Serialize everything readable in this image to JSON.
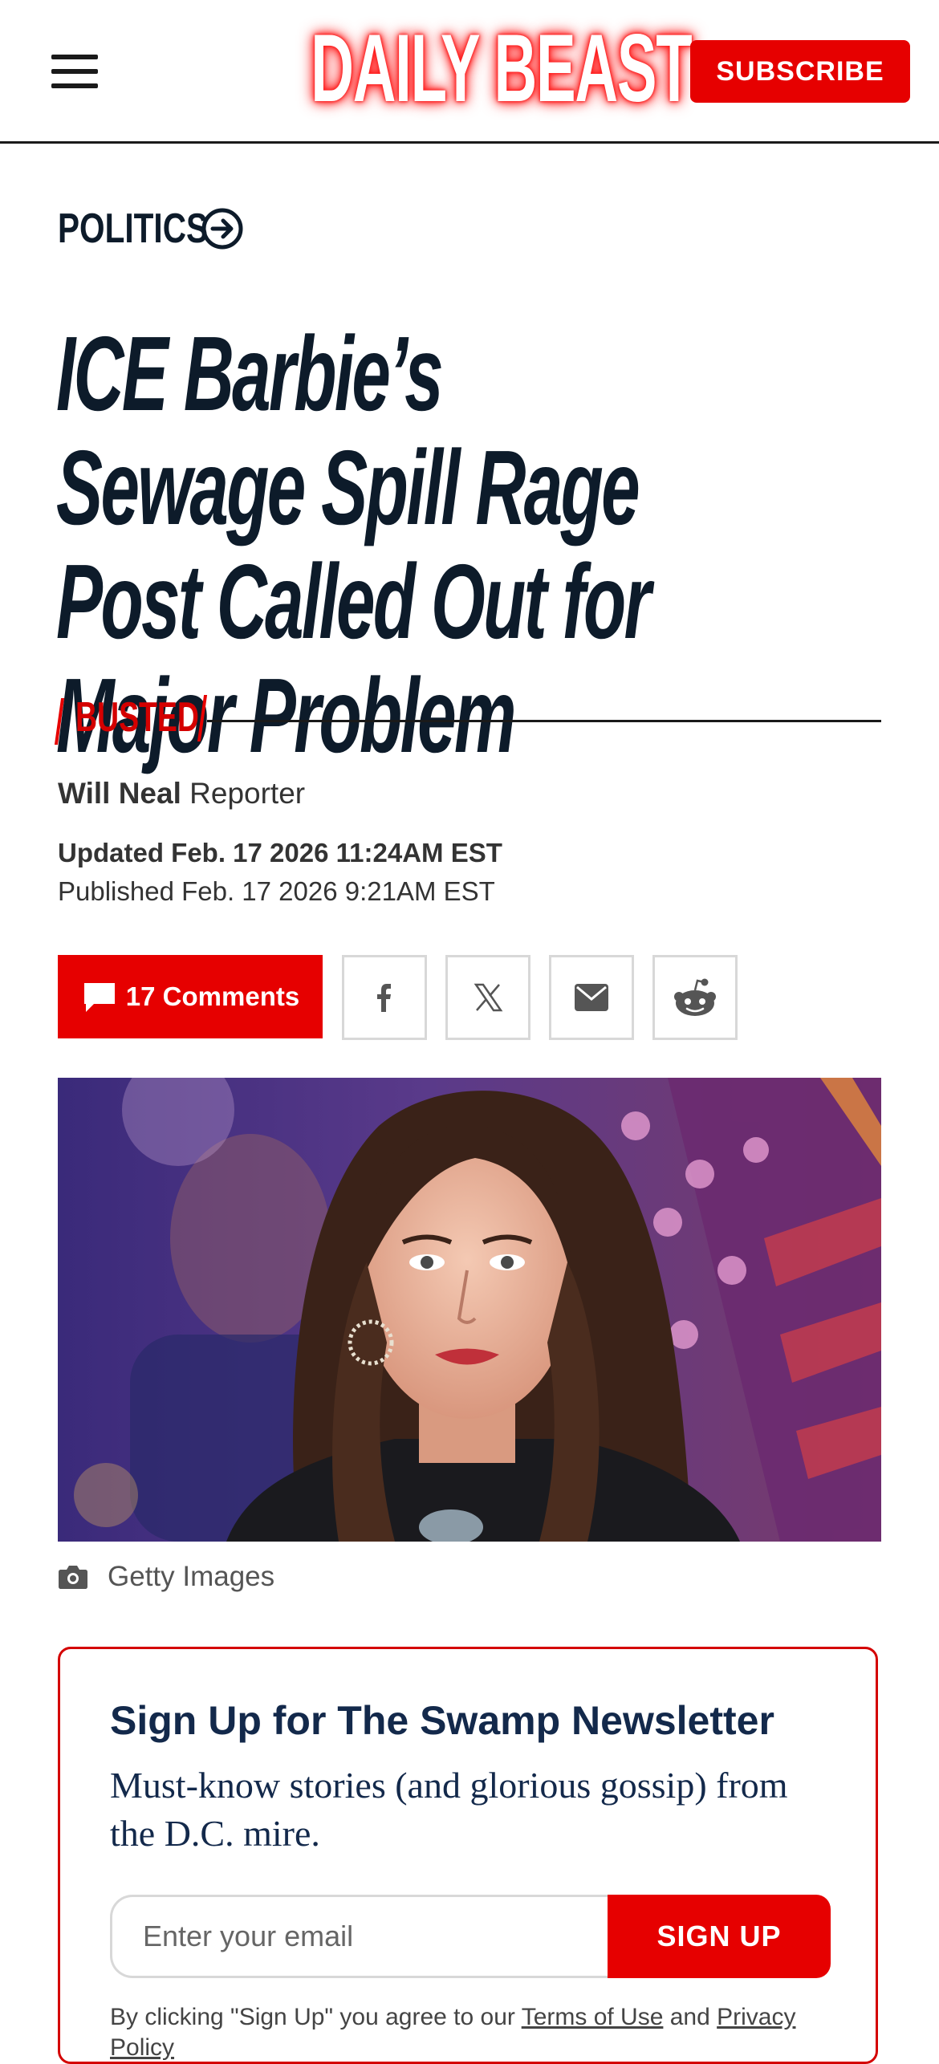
{
  "header": {
    "logo": "DAILY BEAST",
    "subscribe_label": "SUBSCRIBE"
  },
  "article": {
    "section": "POLITICS",
    "headline": "ICE Barbie’s Sewage Spill Rage Post Called Out for Major Problem",
    "tag": "BUSTED",
    "author": "Will Neal",
    "author_role": "Reporter",
    "updated": "Updated Feb. 17 2026 11:24AM EST",
    "published": "Published Feb. 17 2026 9:21AM EST",
    "comments_label": "17 Comments",
    "image_credit": "Getty Images"
  },
  "share": {
    "icons": [
      "facebook-icon",
      "x-icon",
      "email-icon",
      "reddit-icon"
    ]
  },
  "newsletter": {
    "title": "Sign Up for The Swamp Newsletter",
    "description": "Must-know stories (and glorious gossip) from the D.C. mire.",
    "email_placeholder": "Enter your email",
    "signup_label": "SIGN UP",
    "legal_prefix": "By clicking \"Sign Up\" you agree to our ",
    "terms_link": "Terms of Use",
    "legal_and": " and ",
    "privacy_link": "Privacy Policy"
  },
  "colors": {
    "accent": "#e60000",
    "headline": "#0d1b2a",
    "newsletter_text": "#13294b"
  }
}
